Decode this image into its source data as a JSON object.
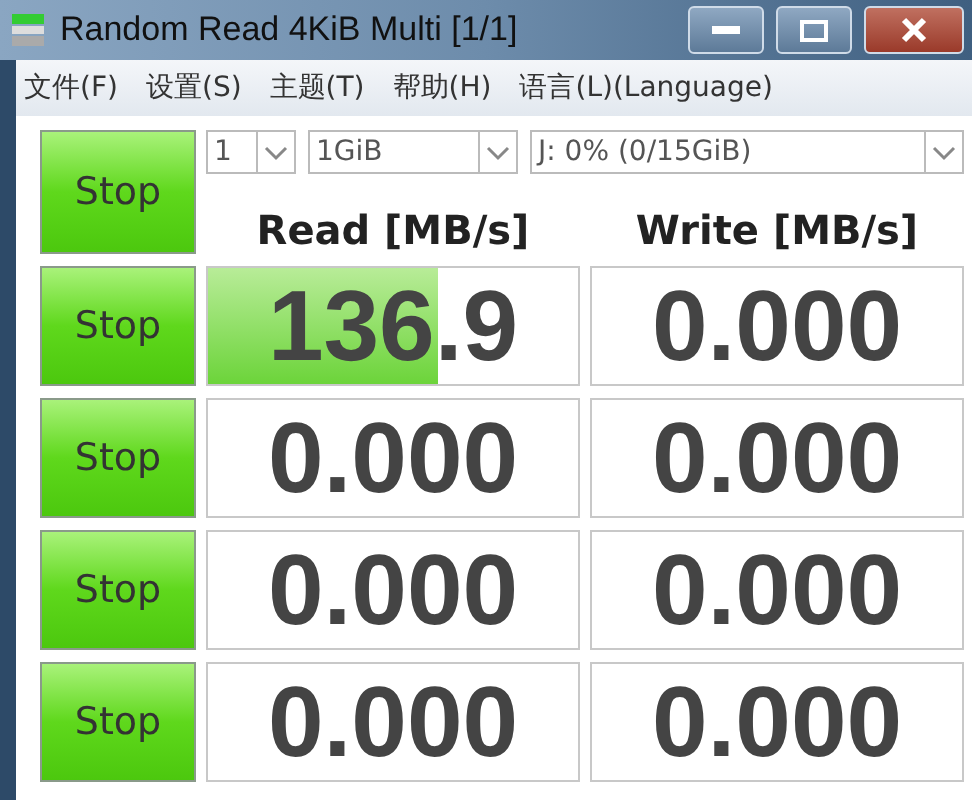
{
  "window": {
    "title": "Random Read 4KiB Multi [1/1]"
  },
  "menu": [
    "文件(F)",
    "设置(S)",
    "主题(T)",
    "帮助(H)",
    "语言(L)(Language)"
  ],
  "selects": [
    {
      "value": "1"
    },
    {
      "value": "1GiB"
    },
    {
      "value": "J: 0% (0/15GiB)"
    }
  ],
  "all_button": "Stop",
  "headers": [
    "Read [MB/s]",
    "Write [MB/s]"
  ],
  "rows": [
    {
      "button": "Stop",
      "read": {
        "value": "136.9",
        "level": 0.62
      },
      "write": {
        "value": "0.000"
      }
    },
    {
      "button": "Stop",
      "read": {
        "value": "0.000"
      },
      "write": {
        "value": "0.000"
      }
    },
    {
      "button": "Stop",
      "read": {
        "value": "0.000"
      },
      "write": {
        "value": "0.000"
      }
    },
    {
      "button": "Stop",
      "read": {
        "value": "0.000"
      },
      "write": {
        "value": "0.000"
      }
    }
  ]
}
